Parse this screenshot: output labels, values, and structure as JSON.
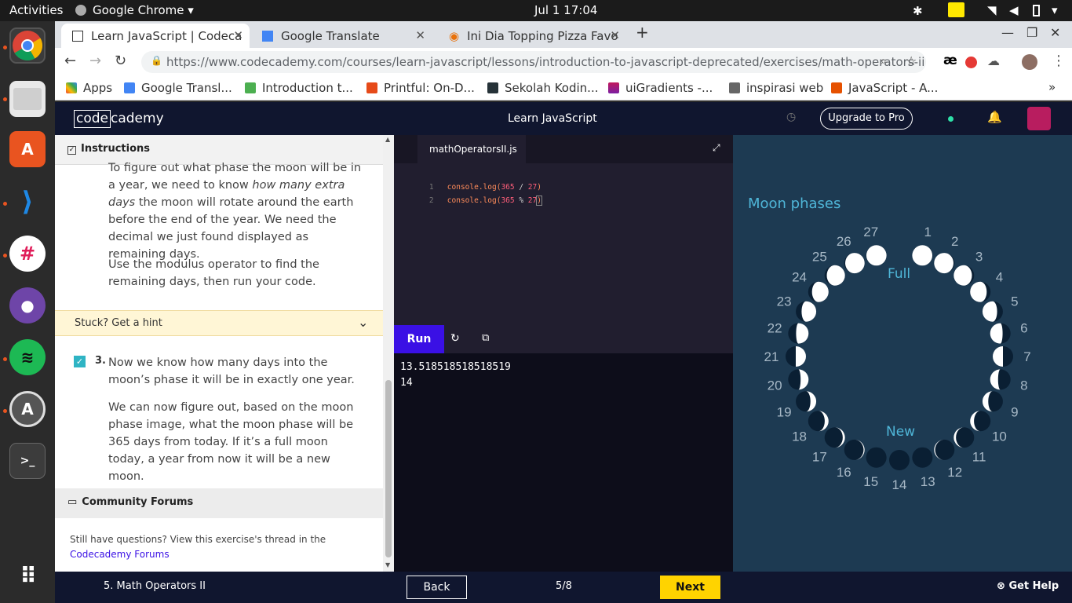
{
  "topbar": {
    "activities": "Activities",
    "app": "Google Chrome",
    "clock": "Jul 1  17:04"
  },
  "tabs": [
    {
      "label": "Learn JavaScript | Codeca",
      "active": true
    },
    {
      "label": "Google Translate",
      "active": false
    },
    {
      "label": "Ini Dia Topping Pizza Favo",
      "active": false
    }
  ],
  "address": {
    "url": "https://www.codecademy.com/courses/learn-javascript/lessons/introduction-to-javascript-deprecated/exercises/math-operators-ii?action=r..."
  },
  "bookmarks": [
    "Apps",
    "Google Transl...",
    "Introduction t...",
    "Printful: On-D...",
    "Sekolah Kodin...",
    "uiGradients -...",
    "inspirasi web",
    "JavaScript - A..."
  ],
  "ccnav": {
    "logo_box": "code",
    "logo_rest": "cademy",
    "course": "Learn JavaScript",
    "upgrade": "Upgrade to Pro"
  },
  "instructions": {
    "header": "Instructions",
    "p1_a": "To figure out what phase the moon will be in a year, we need to know ",
    "p1_em": "how many extra days",
    "p1_b": " the moon will rotate around the earth before the end of the year. We need the decimal we just found displayed as remaining days.",
    "p2": "Use the modulus operator to find the remaining days, then run your code.",
    "hint": "Stuck? Get a hint",
    "step_num": "3.",
    "step_p1": "Now we know how many days into the moon’s phase it will be in exactly one year.",
    "step_p2": "We can now figure out, based on the moon phase image, what the moon phase will be 365 days from today. If it’s a full moon today, a year from now it will be a new moon.",
    "forums_header": "Community Forums",
    "forums_text": "Still have questions? View this exercise's thread in the",
    "forums_link": "Codecademy Forums"
  },
  "editor": {
    "filename": "mathOperatorsII.js",
    "lines": [
      {
        "num": "1",
        "pre": "console.log(",
        "num_a": "365",
        "op": " / ",
        "num_b": "27",
        "post": ")"
      },
      {
        "num": "2",
        "pre": "console.log(",
        "num_a": "365",
        "op": " % ",
        "num_b": "27",
        "post": ")"
      }
    ],
    "run": "Run"
  },
  "console": {
    "lines": [
      "13.518518518518519",
      "14"
    ]
  },
  "moon": {
    "title": "Moon phases",
    "full": "Full",
    "new": "New",
    "days": [
      "1",
      "2",
      "3",
      "4",
      "5",
      "6",
      "7",
      "8",
      "9",
      "10",
      "11",
      "12",
      "13",
      "14",
      "15",
      "16",
      "17",
      "18",
      "19",
      "20",
      "21",
      "22",
      "23",
      "24",
      "25",
      "26",
      "27"
    ]
  },
  "bottom": {
    "lesson": "5. Math Operators II",
    "back": "Back",
    "progress": "5/8",
    "next": "Next",
    "help": "Get Help"
  },
  "colors": {
    "accent": "#3a10e5",
    "next": "#ffd300",
    "nav": "#10162f",
    "hint": "#fff6d6",
    "moonbg": "#1d3a52"
  }
}
